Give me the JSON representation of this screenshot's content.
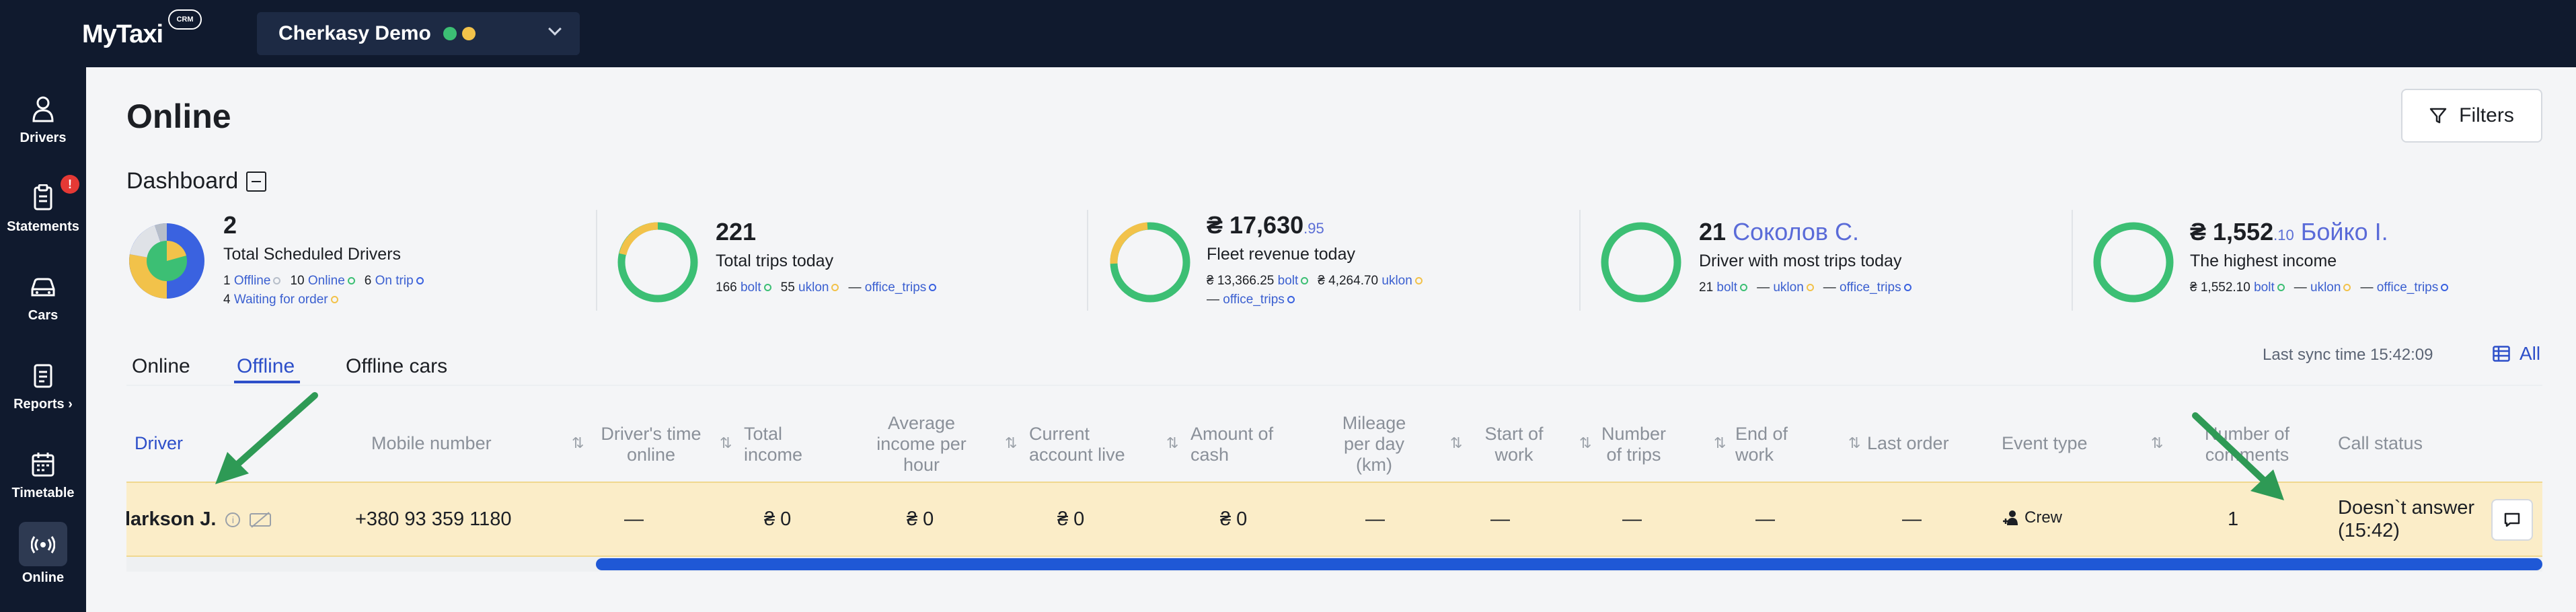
{
  "topbar": {
    "logo": "MyTaxi",
    "logo_badge": "CRM",
    "city": "Cherkasy Demo"
  },
  "sidebar": {
    "items": [
      {
        "label": "Drivers",
        "icon": "person-icon"
      },
      {
        "label": "Statements",
        "icon": "clipboard-icon",
        "badge": "!"
      },
      {
        "label": "Cars",
        "icon": "car-icon"
      },
      {
        "label": "Reports ›",
        "icon": "report-icon"
      },
      {
        "label": "Timetable",
        "icon": "calendar-icon"
      },
      {
        "label": "Online",
        "icon": "broadcast-icon",
        "active": true
      }
    ]
  },
  "header": {
    "title": "Online",
    "filters_label": "Filters"
  },
  "dashboard": {
    "title": "Dashboard",
    "stats": [
      {
        "value": "2",
        "label": "Total Scheduled Drivers",
        "sub1": [
          {
            "n": "1",
            "t": "Offline",
            "c": "#b7bec9"
          },
          {
            "n": "10",
            "t": "Online",
            "c": "#3cbf74"
          },
          {
            "n": "6",
            "t": "On trip",
            "c": "#3a62e0"
          }
        ],
        "sub2": [
          {
            "n": "4",
            "t": "Waiting for order",
            "c": "#f2c24a"
          }
        ]
      },
      {
        "value": "221",
        "label": "Total trips today",
        "sub1": [
          {
            "n": "166",
            "t": "bolt",
            "c": "#3cbf74"
          },
          {
            "n": "55",
            "t": "uklon",
            "c": "#f2c24a"
          },
          {
            "n": "—",
            "t": "office_trips",
            "c": "#3a62e0"
          }
        ]
      },
      {
        "value": "₴ 17,630",
        "decimal": ".95",
        "label": "Fleet revenue today",
        "sub1": [
          {
            "n": "₴ 13,366.25",
            "t": "bolt",
            "c": "#3cbf74"
          },
          {
            "n": "₴ 4,264.70",
            "t": "uklon",
            "c": "#f2c24a"
          }
        ],
        "sub2": [
          {
            "n": "—",
            "t": "office_trips",
            "c": "#3a62e0"
          }
        ]
      },
      {
        "value": "21",
        "name": "Соколов С.",
        "label": "Driver with most trips today",
        "sub1": [
          {
            "n": "21",
            "t": "bolt",
            "c": "#3cbf74"
          },
          {
            "n": "—",
            "t": "uklon",
            "c": "#f2c24a"
          },
          {
            "n": "—",
            "t": "office_trips",
            "c": "#3a62e0"
          }
        ]
      },
      {
        "value": "₴ 1,552",
        "decimal": ".10",
        "name": "Бойко І.",
        "label": "The highest income",
        "sub1": [
          {
            "n": "₴ 1,552.10",
            "t": "bolt",
            "c": "#3cbf74"
          },
          {
            "n": "—",
            "t": "uklon",
            "c": "#f2c24a"
          },
          {
            "n": "—",
            "t": "office_trips",
            "c": "#3a62e0"
          }
        ]
      }
    ]
  },
  "tabs": [
    "Online",
    "Offline",
    "Offline cars"
  ],
  "active_tab": "Offline",
  "sync": "Last sync time 15:42:09",
  "all_label": "All",
  "table": {
    "headers": {
      "driver": "Driver",
      "mobile": "Mobile number",
      "time_online": "Driver's time online",
      "total_income": "Total income",
      "avg_income": "Average income per hour",
      "account_live": "Current account live",
      "cash": "Amount of cash",
      "mileage": "Mileage per day (km)",
      "start": "Start of work",
      "trips": "Number of trips",
      "end": "End of work",
      "last_order": "Last order",
      "event": "Event type",
      "comments": "Number of comments",
      "call": "Call status"
    },
    "rows": [
      {
        "driver": "larkson J.",
        "mobile": "+380 93 359 1180",
        "time_online": "—",
        "total_income": "₴ 0",
        "avg_income": "₴ 0",
        "account_live": "₴ 0",
        "cash": "₴ 0",
        "mileage": "—",
        "start": "—",
        "trips": "—",
        "end": "—",
        "last_order": "—",
        "event": "Crew",
        "comments": "1",
        "call_line1": "Doesn`t answer",
        "call_line2": "(15:42)"
      }
    ]
  },
  "colors": {
    "brand_dark": "#101a2e",
    "accent": "#2d4fc9",
    "row_highlight": "#fbedc8",
    "annotation_arrow": "#2e9a55"
  }
}
